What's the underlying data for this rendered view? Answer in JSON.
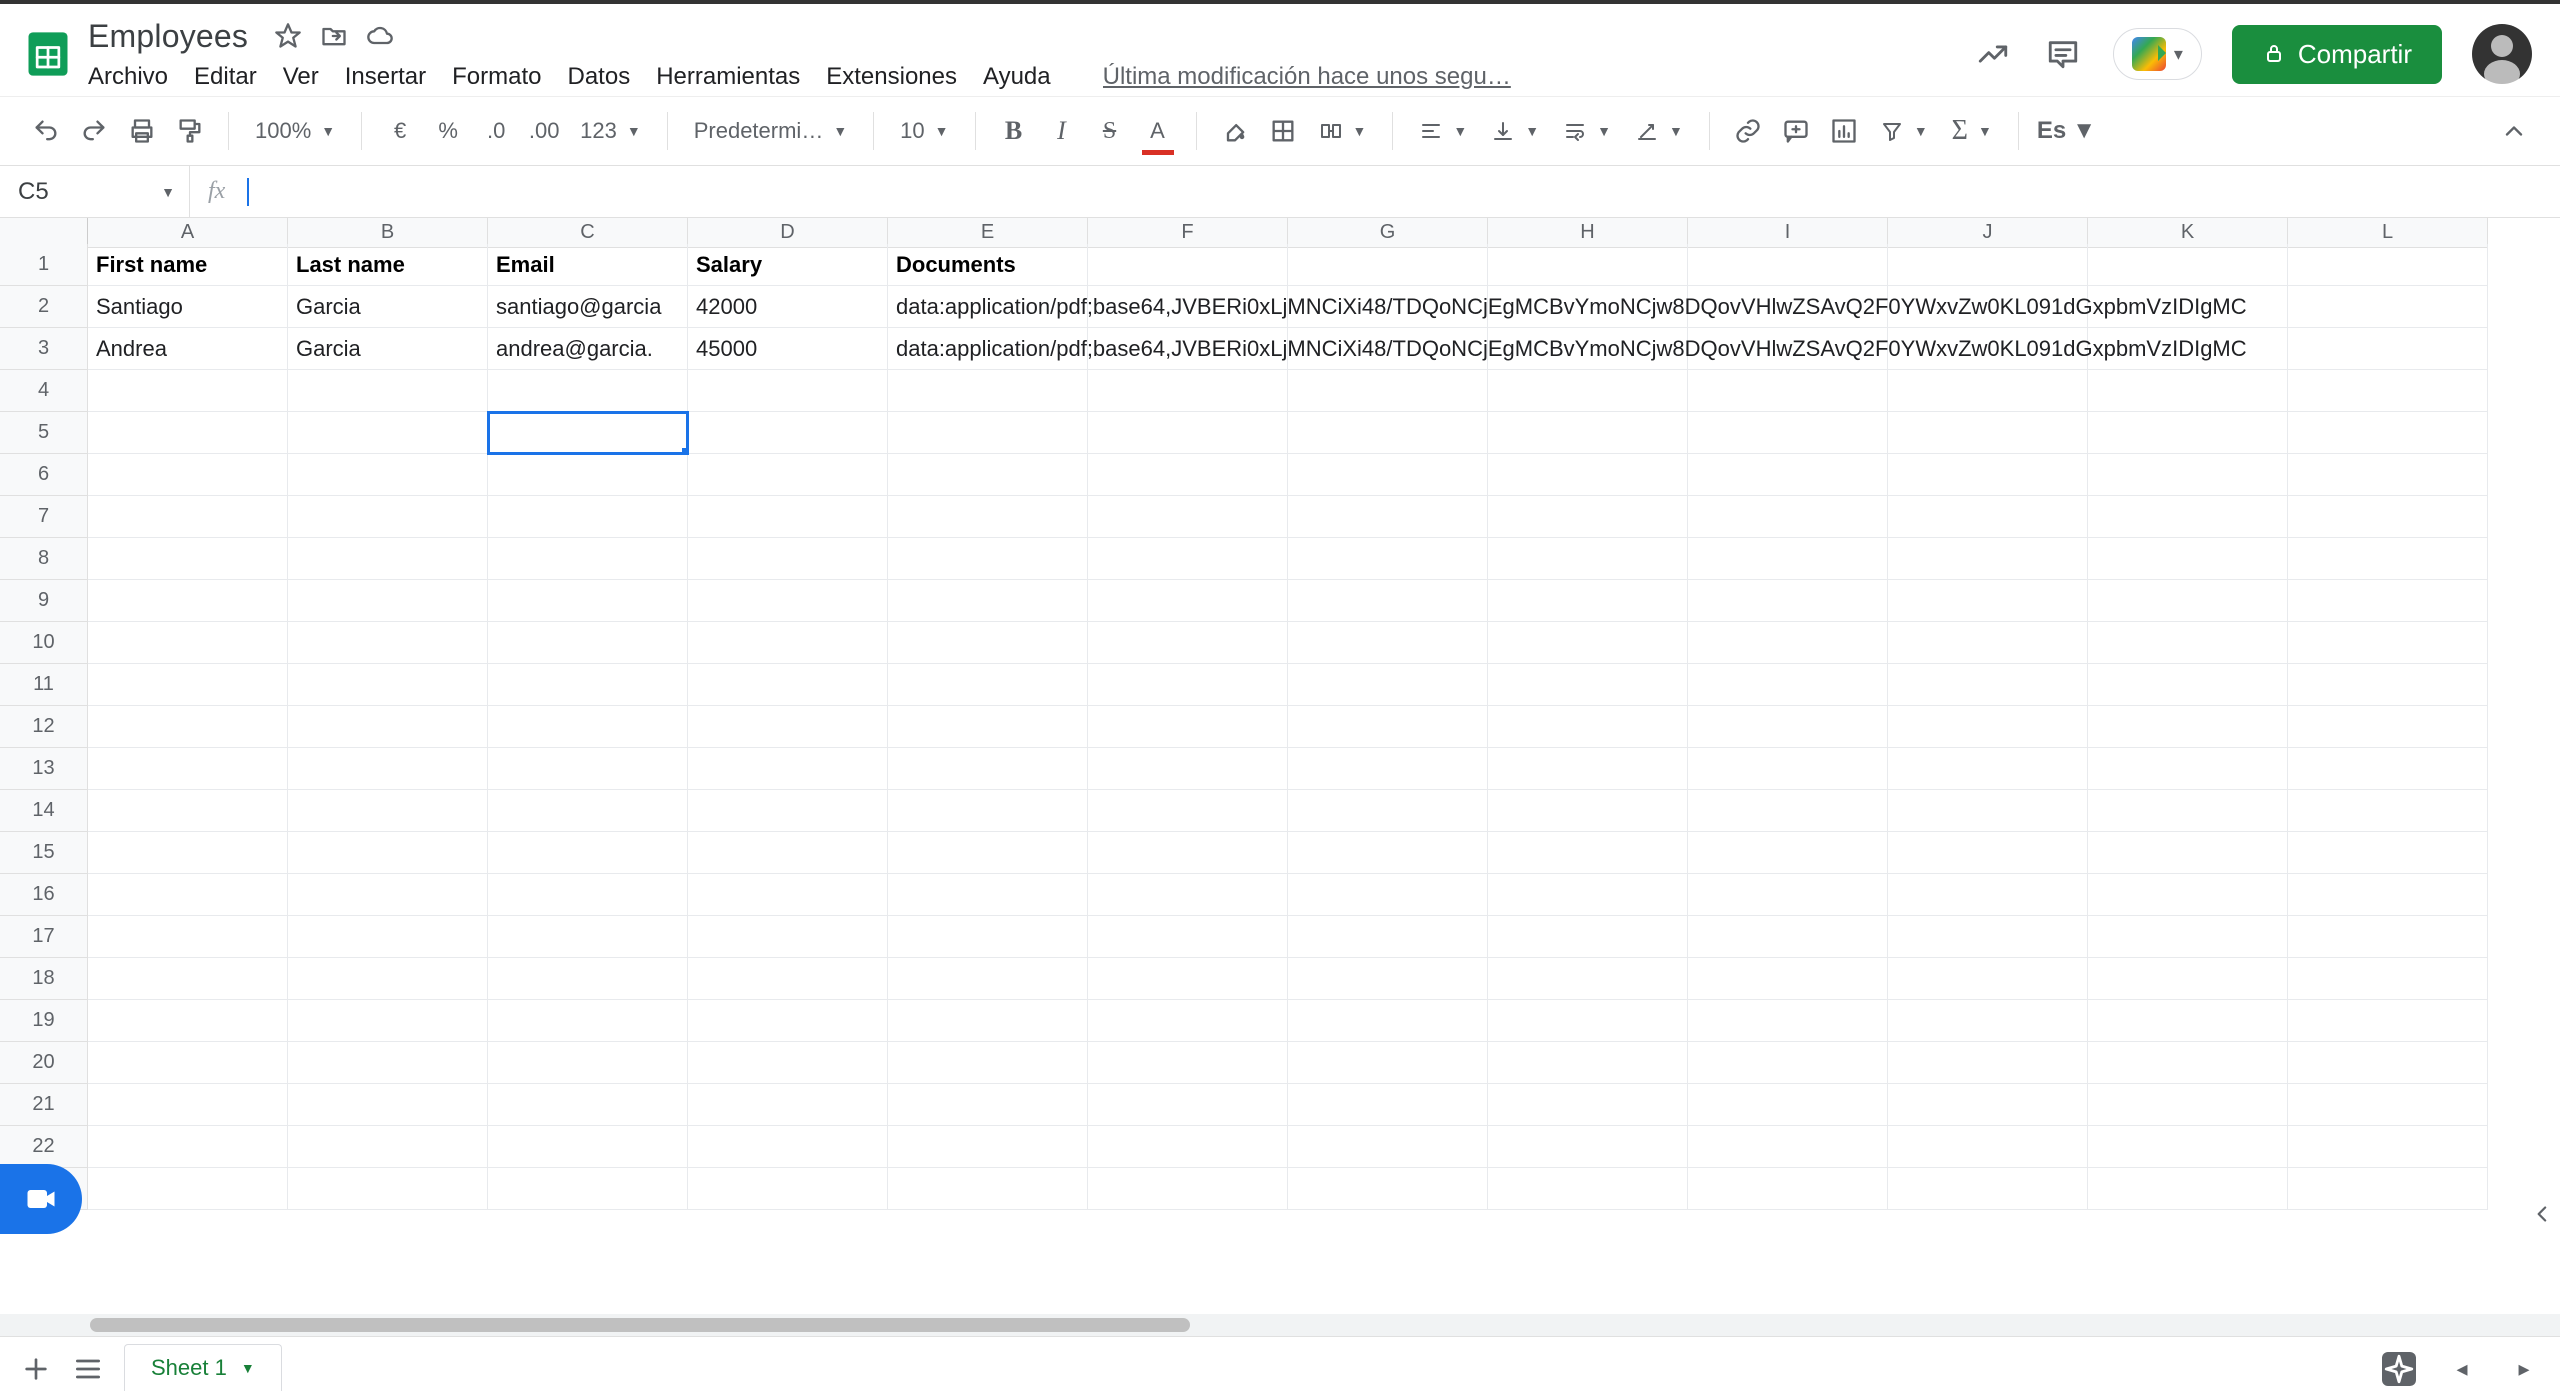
{
  "doc": {
    "title": "Employees"
  },
  "menus": {
    "file": "Archivo",
    "edit": "Editar",
    "view": "Ver",
    "insert": "Insertar",
    "format": "Formato",
    "data": "Datos",
    "tools": "Herramientas",
    "extensions": "Extensiones",
    "help": "Ayuda",
    "last_modified": "Última modificación hace unos segu…"
  },
  "actions": {
    "share": "Compartir"
  },
  "toolbar": {
    "zoom": "100%",
    "currency": "€",
    "percent": "%",
    "dec_less": ".0",
    "dec_more": ".00",
    "more_formats": "123",
    "font": "Predetermi…",
    "font_size": "10",
    "lang": "Es"
  },
  "namebox": {
    "ref": "C5"
  },
  "columns": [
    "A",
    "B",
    "C",
    "D",
    "E",
    "F",
    "G",
    "H",
    "I",
    "J",
    "K",
    "L"
  ],
  "row_count": 23,
  "headers": {
    "A": "First name",
    "B": "Last name",
    "C": "Email",
    "D": "Salary",
    "E": "Documents"
  },
  "rows": [
    {
      "A": "Santiago",
      "B": "Garcia",
      "C": "santiago@garcia",
      "D": "42000",
      "E": "data:application/pdf;base64,JVBERi0xLjMNCiXi48/TDQoNCjEgMCBvYmoNCjw8DQovVHlwZSAvQ2F0YWxvZw0KL091dGxpbmVzIDIgMC"
    },
    {
      "A": "Andrea",
      "B": "Garcia",
      "C": "andrea@garcia.",
      "D": "45000",
      "E": "data:application/pdf;base64,JVBERi0xLjMNCiXi48/TDQoNCjEgMCBvYmoNCjw8DQovVHlwZSAvQ2F0YWxvZw0KL091dGxpbmVzIDIgMC"
    }
  ],
  "selected_cell": "C5",
  "sheetbar": {
    "tab": "Sheet 1"
  }
}
